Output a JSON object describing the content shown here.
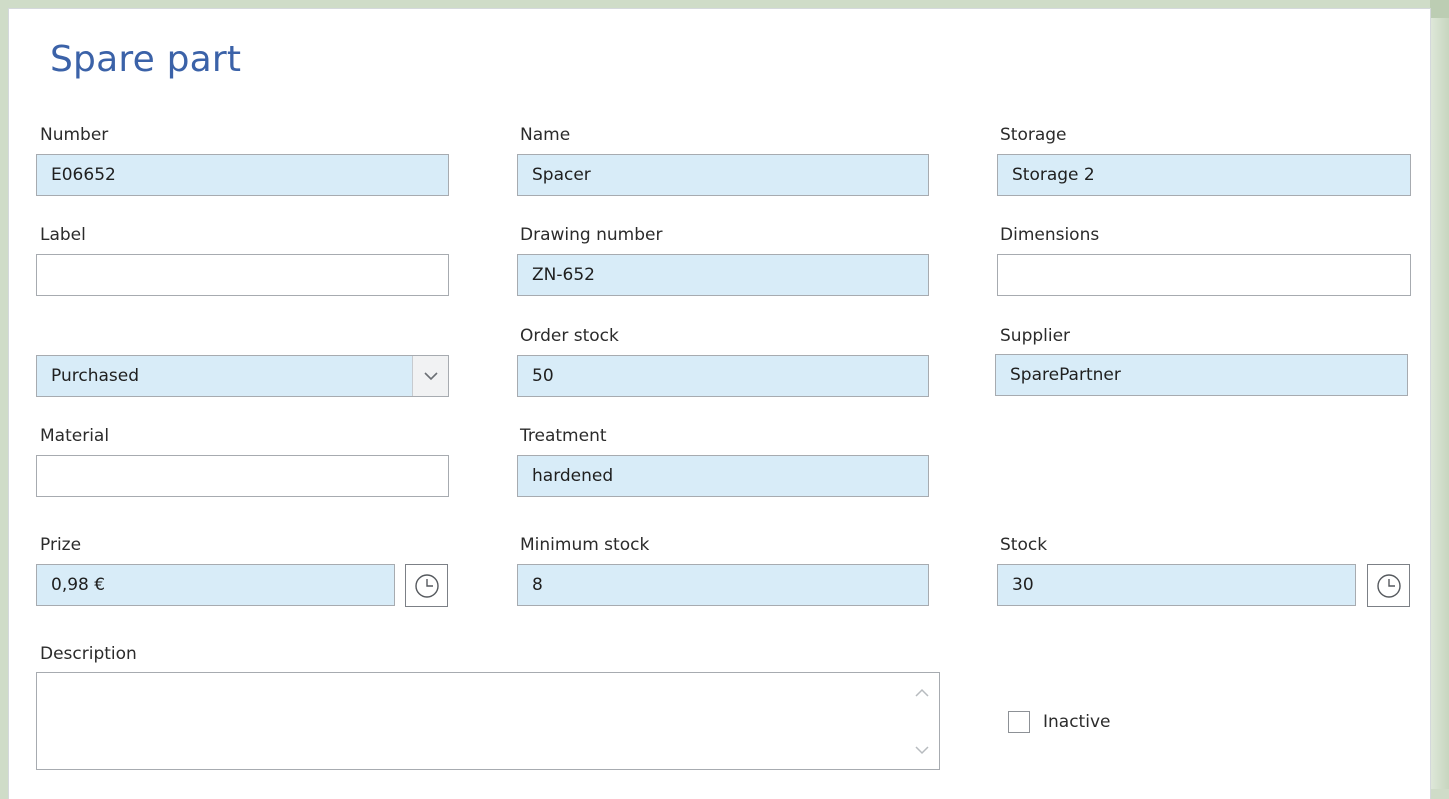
{
  "form": {
    "title": "Spare part",
    "number": {
      "label": "Number",
      "value": "E06652"
    },
    "name": {
      "label": "Name",
      "value": "Spacer"
    },
    "storage": {
      "label": "Storage",
      "value": "Storage 2"
    },
    "label_field": {
      "label": "Label",
      "value": ""
    },
    "drawing_number": {
      "label": "Drawing number",
      "value": "ZN-652"
    },
    "dimensions": {
      "label": "Dimensions",
      "value": ""
    },
    "procurement": {
      "selected": "Purchased"
    },
    "order_stock": {
      "label": "Order stock",
      "value": "50"
    },
    "supplier": {
      "label": "Supplier",
      "value": "SparePartner"
    },
    "material": {
      "label": "Material",
      "value": ""
    },
    "treatment": {
      "label": "Treatment",
      "value": "hardened"
    },
    "prize": {
      "label": "Prize",
      "value": "0,98 €"
    },
    "minimum_stock": {
      "label": "Minimum stock",
      "value": "8"
    },
    "stock": {
      "label": "Stock",
      "value": "30"
    },
    "description": {
      "label": "Description",
      "value": ""
    },
    "inactive": {
      "label": "Inactive",
      "checked": false
    }
  },
  "icons": {
    "history": "clock-icon",
    "dropdown": "chevron-down-icon",
    "scroll_up": "chevron-up-icon",
    "scroll_down": "chevron-down-icon"
  },
  "colors": {
    "title": "#3b62a8",
    "filled_field": "#d8ecf8",
    "border": "#a7abb0"
  }
}
